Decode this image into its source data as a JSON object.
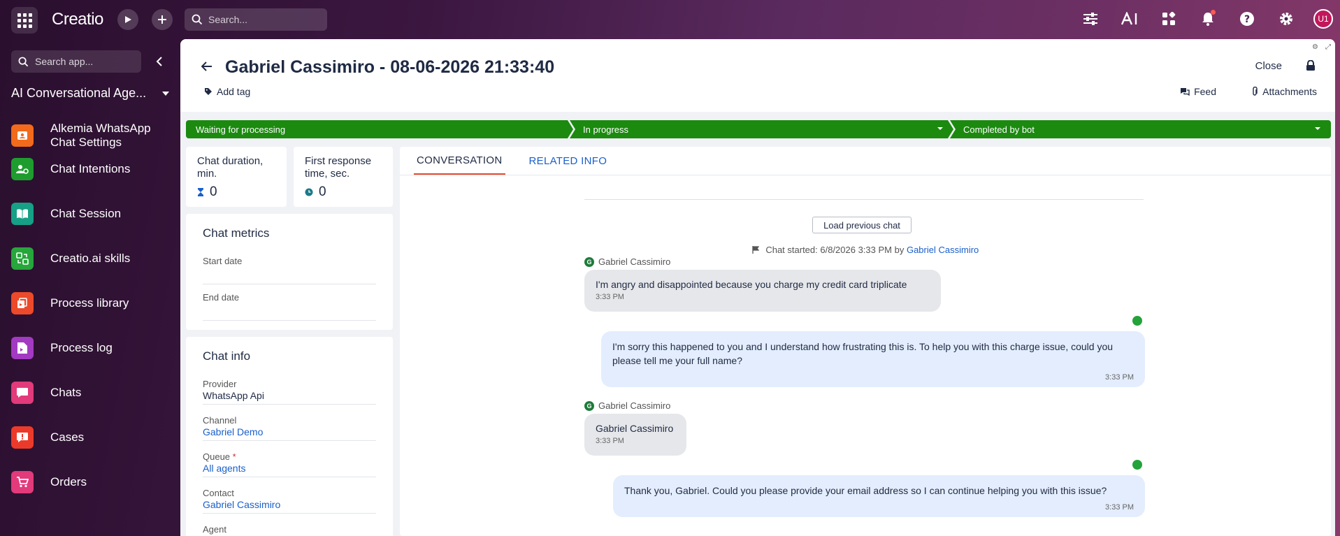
{
  "topbar": {
    "logo": "Creatio",
    "search_placeholder": "Search...",
    "avatar_initials": "U1"
  },
  "sidebar": {
    "search_placeholder": "Search app...",
    "workplace": "AI Conversational Age...",
    "items": [
      {
        "label": "Alkemia WhatsApp Chat Settings",
        "color": "#f26a1b",
        "icon": "contact-card-icon"
      },
      {
        "label": "Chat Intentions",
        "color": "#1e9d2e",
        "icon": "users-gear-icon"
      },
      {
        "label": "Chat Session",
        "color": "#16a085",
        "icon": "book-icon"
      },
      {
        "label": "Creatio.ai skills",
        "color": "#26a63b",
        "icon": "skills-icon"
      },
      {
        "label": "Process library",
        "color": "#ec4a2a",
        "icon": "process-icon"
      },
      {
        "label": "Process log",
        "color": "#a33ac2",
        "icon": "log-icon"
      },
      {
        "label": "Chats",
        "color": "#e23a7a",
        "icon": "chat-icon"
      },
      {
        "label": "Cases",
        "color": "#ec3a2a",
        "icon": "case-icon"
      },
      {
        "label": "Orders",
        "color": "#e23a7a",
        "icon": "cart-icon"
      }
    ]
  },
  "header": {
    "title": "Gabriel Cassimiro - 08-06-2026 21:33:40",
    "add_tag": "Add tag",
    "close": "Close",
    "feed": "Feed",
    "attachments": "Attachments"
  },
  "stages": [
    {
      "label": "Waiting for processing"
    },
    {
      "label": "In progress"
    },
    {
      "label": "Completed by bot"
    }
  ],
  "metrics": {
    "duration_label": "Chat duration, min.",
    "duration_value": "0",
    "first_response_label": "First response time, sec.",
    "first_response_value": "0"
  },
  "chat_metrics": {
    "title": "Chat metrics",
    "start_date_label": "Start date",
    "end_date_label": "End date"
  },
  "chat_info": {
    "title": "Chat info",
    "provider_label": "Provider",
    "provider_value": "WhatsApp Api",
    "channel_label": "Channel",
    "channel_value": "Gabriel Demo",
    "queue_label": "Queue",
    "queue_required": "*",
    "queue_value": "All agents",
    "contact_label": "Contact",
    "contact_value": "Gabriel Cassimiro",
    "agent_label": "Agent"
  },
  "conversation": {
    "tabs": [
      "CONVERSATION",
      "RELATED INFO"
    ],
    "load_previous": "Load previous chat",
    "chat_started_text": "Chat started: 6/8/2026 3:33 PM by",
    "chat_started_by": "Gabriel Cassimiro",
    "messages": [
      {
        "sender": "Gabriel Cassimiro",
        "text": "I'm angry and disappointed because you charge my credit card triplicate",
        "time": "3:33 PM"
      },
      {
        "text": "I'm sorry this happened to you and I understand how frustrating this is. To help you with this charge issue, could you please tell me your full name?",
        "time": "3:33 PM"
      },
      {
        "sender": "Gabriel Cassimiro",
        "text": "Gabriel Cassimiro",
        "time": "3:33 PM"
      },
      {
        "text": "Thank you, Gabriel. Could you please provide your email address so I can continue helping you with this issue?",
        "time": "3:33 PM"
      }
    ]
  }
}
